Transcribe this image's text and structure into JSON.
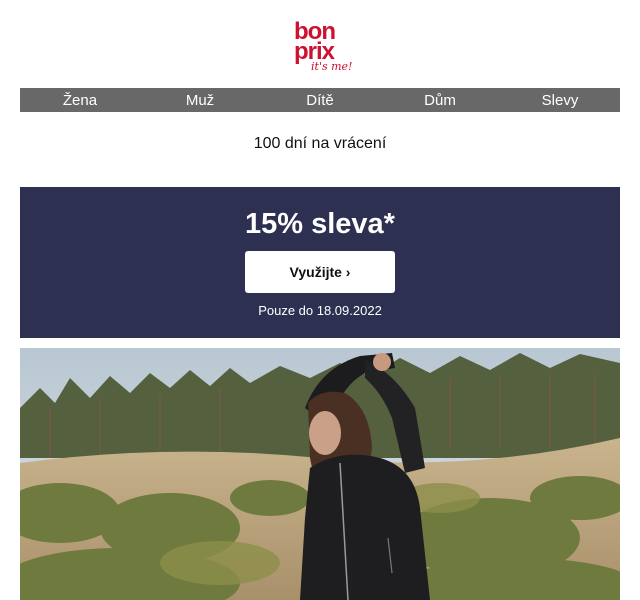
{
  "logo": {
    "line1": "bon",
    "line2": "prix",
    "tagline": "it's me!"
  },
  "nav": {
    "items": [
      {
        "label": "Žena"
      },
      {
        "label": "Muž"
      },
      {
        "label": "Dítě"
      },
      {
        "label": "Dům"
      },
      {
        "label": "Slevy"
      }
    ]
  },
  "returns_text": "100 dní na vrácení",
  "promo": {
    "title": "15% sleva*",
    "button_label": "Využijte ›",
    "note": "Pouze do 18.09.2022"
  },
  "colors": {
    "brand": "#cc1131",
    "nav_bg": "#686868",
    "promo_bg": "#2e3051"
  }
}
